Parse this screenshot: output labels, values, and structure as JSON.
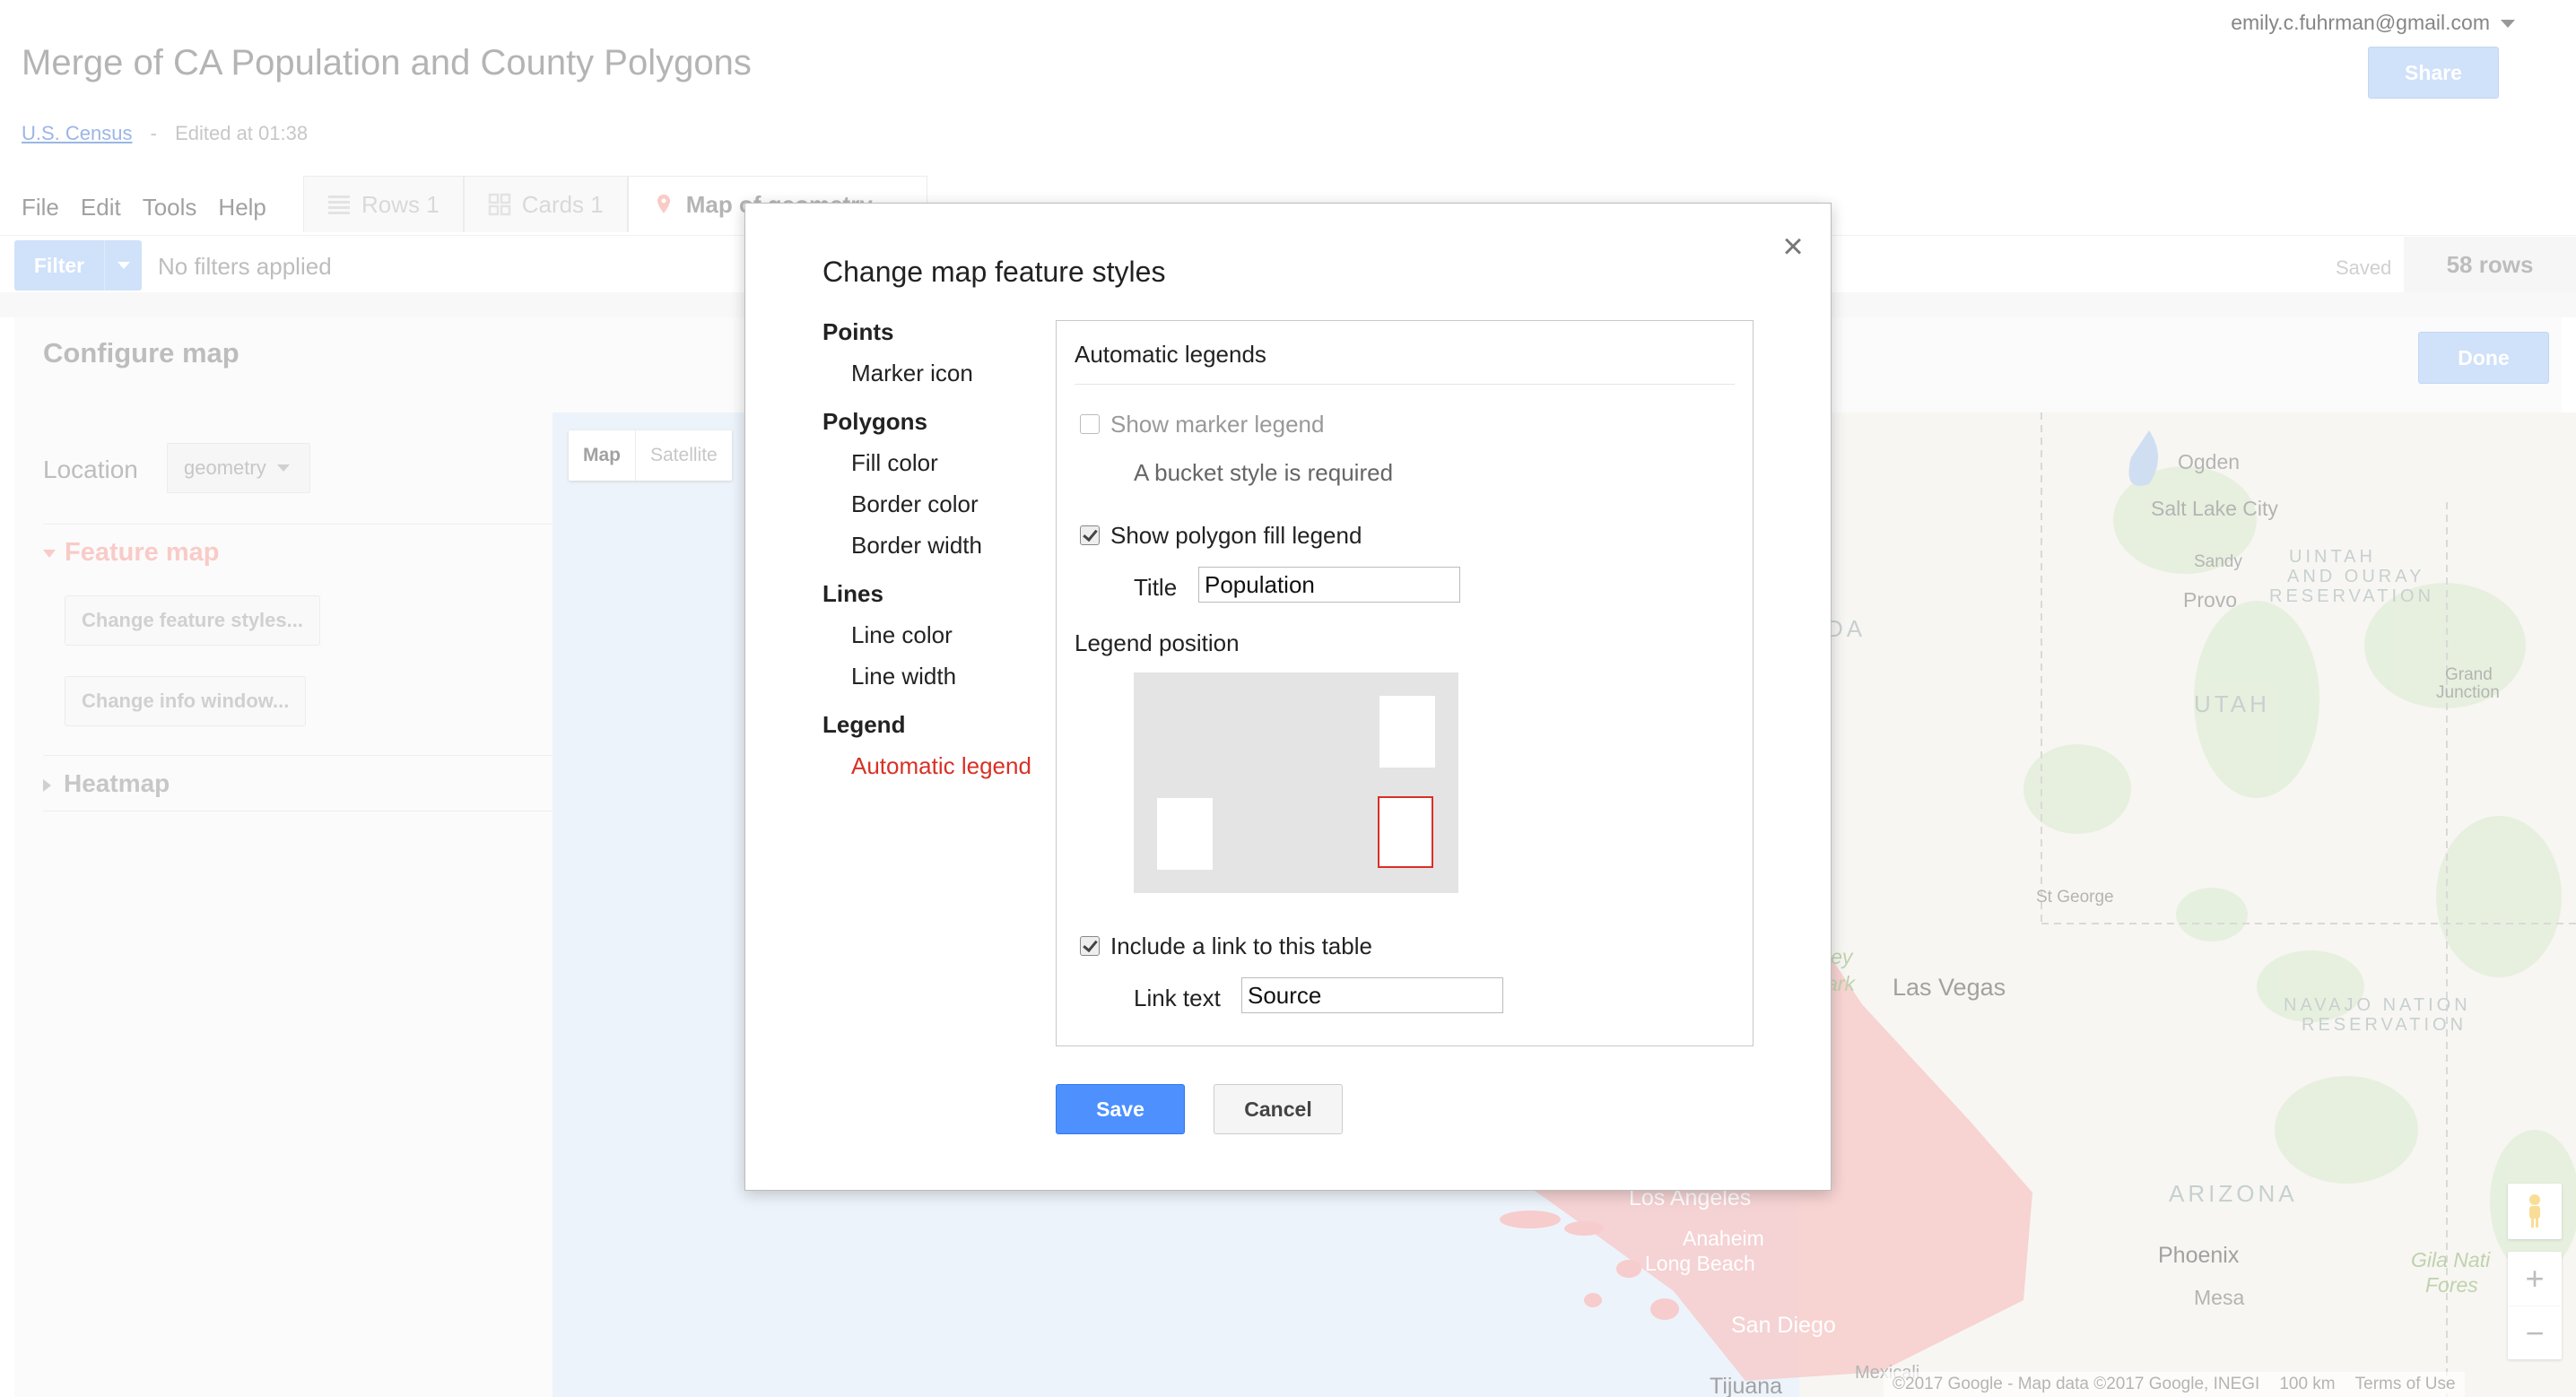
{
  "app": {
    "title": "Merge of CA Population and County Polygons",
    "source_link": "U.S. Census",
    "separator": "-",
    "edited": "Edited at 01:38",
    "account_email": "emily.c.fuhrman@gmail.com",
    "share_label": "Share"
  },
  "menu": [
    "File",
    "Edit",
    "Tools",
    "Help"
  ],
  "tabs": [
    {
      "label": "Rows 1",
      "icon": "rows-icon"
    },
    {
      "label": "Cards 1",
      "icon": "cards-icon"
    },
    {
      "label": "Map of geometry",
      "icon": "map-pin-icon"
    }
  ],
  "filterbar": {
    "filter_label": "Filter",
    "status": "No filters applied",
    "saved": "Saved",
    "row_count": "58 rows"
  },
  "configure": {
    "title": "Configure map",
    "done_label": "Done",
    "location_label": "Location",
    "location_value": "geometry",
    "feature_map_label": "Feature map",
    "change_styles_label": "Change feature styles...",
    "change_info_label": "Change info window...",
    "heatmap_label": "Heatmap"
  },
  "map": {
    "type_map": "Map",
    "type_satellite": "Satellite",
    "labels": [
      "Ogden",
      "Salt Lake City",
      "Sandy",
      "Provo",
      "UINTAH",
      "AND OURAY",
      "RESERVATION",
      "UTAH",
      "Grand",
      "Junction",
      "DA",
      "St George",
      "Las Vegas",
      "ley",
      "ark",
      "NAVAJO NATION",
      "RESERVATION",
      "ARIZONA",
      "Phoenix",
      "Mesa",
      "Gila Nati",
      "Fores",
      "Los Angeles",
      "Anaheim",
      "Long Beach",
      "San Diego",
      "Tijuana",
      "Mexicali"
    ],
    "attribution": "©2017 Google - Map data ©2017 Google, INEGI",
    "scale": "100 km",
    "terms": "Terms of Use",
    "polygon_color": "#f0a3a3"
  },
  "dialog": {
    "title": "Change map feature styles",
    "close": "×",
    "nav": [
      {
        "heading": "Points",
        "items": [
          "Marker icon"
        ]
      },
      {
        "heading": "Polygons",
        "items": [
          "Fill color",
          "Border color",
          "Border width"
        ]
      },
      {
        "heading": "Lines",
        "items": [
          "Line color",
          "Line width"
        ]
      },
      {
        "heading": "Legend",
        "items": [
          "Automatic legend"
        ]
      }
    ],
    "selected_item": "Automatic legend",
    "panel": {
      "heading": "Automatic legends",
      "show_marker_legend": "Show marker legend",
      "show_marker_legend_checked": false,
      "bucket_note": "A bucket style is required",
      "show_polygon_legend": "Show polygon fill legend",
      "show_polygon_legend_checked": true,
      "title_label": "Title",
      "title_value": "Population",
      "legend_position_label": "Legend position",
      "legend_position_selected": "bottom-right",
      "include_link": "Include a link to this table",
      "include_link_checked": true,
      "link_text_label": "Link text",
      "link_text_value": "Source"
    },
    "save_label": "Save",
    "cancel_label": "Cancel"
  },
  "colors": {
    "accent_blue": "#4d90fe",
    "selected_red": "#d93025",
    "disabled_blue": "#a9c8f6"
  }
}
